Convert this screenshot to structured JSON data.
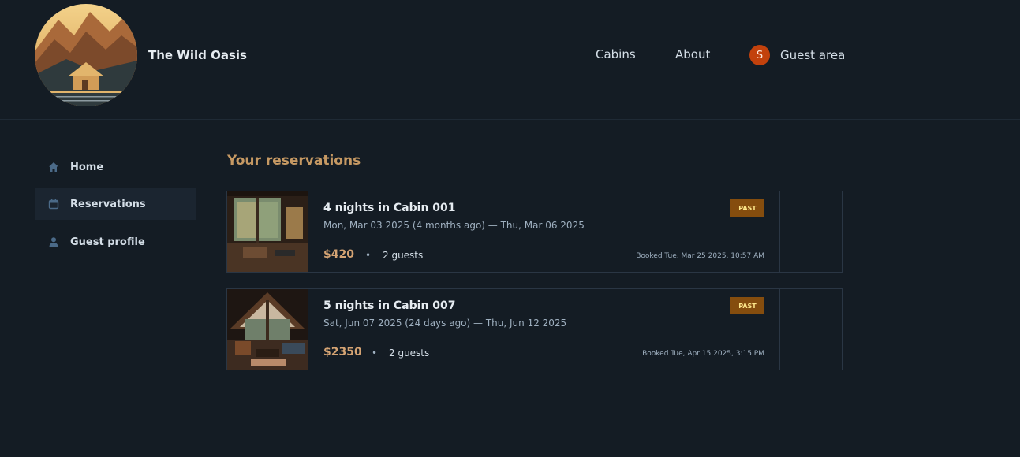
{
  "header": {
    "brand_name": "The Wild Oasis",
    "nav": {
      "cabins": "Cabins",
      "about": "About",
      "guest_area": "Guest area",
      "avatar_initial": "S"
    }
  },
  "sidebar": {
    "items": [
      {
        "label": "Home",
        "icon": "home-icon",
        "active": false
      },
      {
        "label": "Reservations",
        "icon": "calendar-icon",
        "active": true
      },
      {
        "label": "Guest profile",
        "icon": "user-icon",
        "active": false
      }
    ]
  },
  "main": {
    "title": "Your reservations",
    "reservations": [
      {
        "title": "4 nights in Cabin 001",
        "dates": "Mon, Mar 03 2025 (4 months ago) — Thu, Mar 06 2025",
        "status": "PAST",
        "price": "$420",
        "separator": "•",
        "guests": "2 guests",
        "booked": "Booked Tue, Mar 25 2025, 10:57 AM"
      },
      {
        "title": "5 nights in Cabin 007",
        "dates": "Sat, Jun 07 2025 (24 days ago) — Thu, Jun 12 2025",
        "status": "PAST",
        "price": "$2350",
        "separator": "•",
        "guests": "2 guests",
        "booked": "Booked Tue, Apr 15 2025, 3:15 PM"
      }
    ]
  },
  "colors": {
    "background": "#141c24",
    "accent": "#c69963",
    "badge_past": "#854d0e",
    "avatar": "#c2410c"
  }
}
